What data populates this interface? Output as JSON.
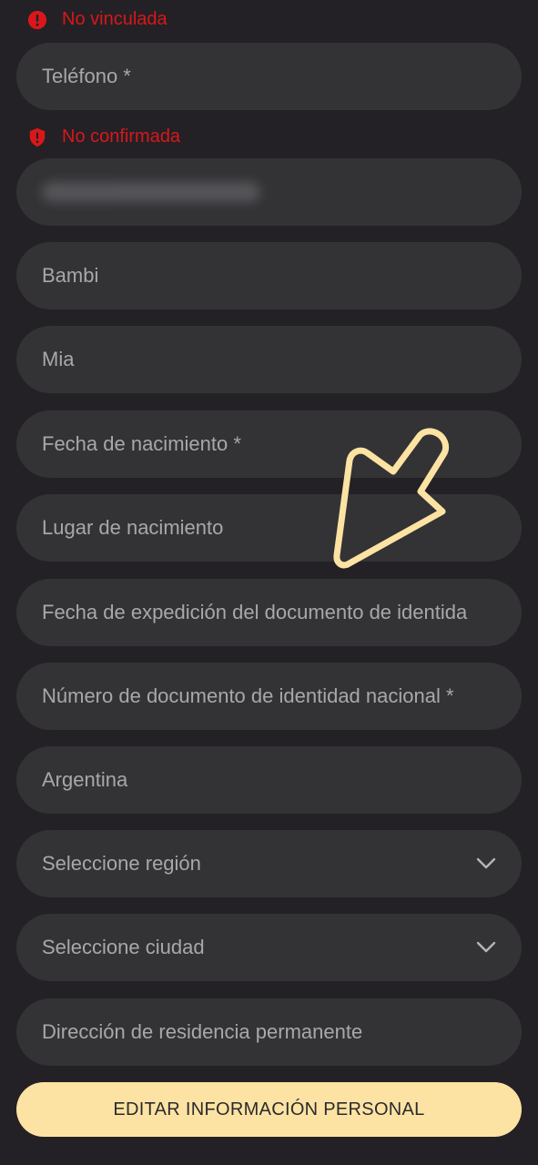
{
  "email_status": "No vinculada",
  "phone_status": "No confirmada",
  "fields": {
    "phone": "Teléfono *",
    "first_name": "Bambi",
    "last_name": "Mia",
    "birth_date": "Fecha de nacimiento *",
    "birth_place": "Lugar de nacimiento",
    "doc_issue_date": "Fecha de expedición del documento de identida",
    "doc_number": "Número de documento de identidad nacional *",
    "country": "Argentina",
    "region": "Seleccione región",
    "city": "Seleccione ciudad",
    "address": "Dirección de residencia permanente"
  },
  "edit_button": "EDITAR INFORMACIÓN PERSONAL",
  "colors": {
    "background": "#232125",
    "field": "#333235",
    "error": "#d9171b",
    "accent": "#fde3a3"
  },
  "icons": {
    "alert": "alert-circle-icon",
    "shield": "shield-alert-icon",
    "chevron": "chevron-down-icon",
    "pointer": "pointer-arrow-icon"
  }
}
